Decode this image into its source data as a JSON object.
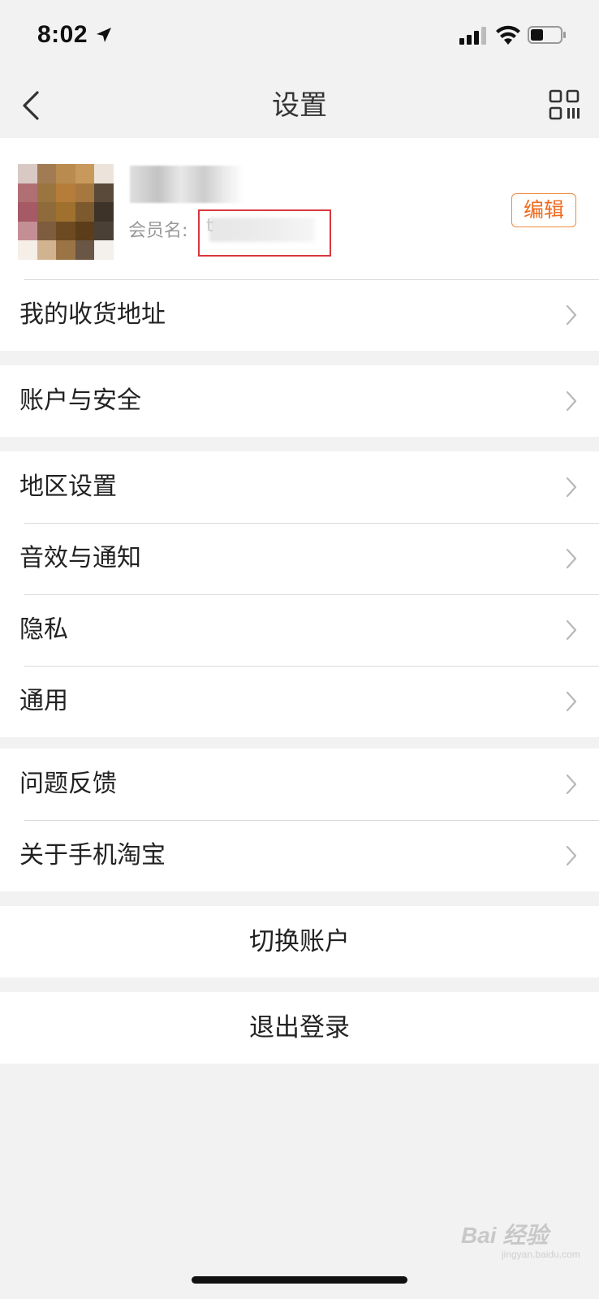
{
  "status_bar": {
    "time": "8:02",
    "icons": [
      "location-arrow-icon",
      "cellular-signal-icon",
      "wifi-icon",
      "battery-icon"
    ]
  },
  "nav": {
    "title": "设置",
    "back_icon": "chevron-left-icon",
    "right_icon": "qr-code-icon"
  },
  "profile": {
    "member_label": "会员名:",
    "member_value": "t",
    "edit_label": "编辑"
  },
  "groups": [
    {
      "items": [
        "我的收货地址"
      ]
    },
    {
      "items": [
        "账户与安全"
      ]
    },
    {
      "items": [
        "地区设置",
        "音效与通知",
        "隐私",
        "通用"
      ]
    },
    {
      "items": [
        "问题反馈",
        "关于手机淘宝"
      ]
    }
  ],
  "actions": {
    "switch_account": "切换账户",
    "logout": "退出登录"
  },
  "watermark": {
    "text": "Bai 经验",
    "sub": "jingyan.baidu.com"
  },
  "colors": {
    "accent": "#f06a1e",
    "highlight_box": "#d9363e",
    "background": "#f2f2f2"
  }
}
